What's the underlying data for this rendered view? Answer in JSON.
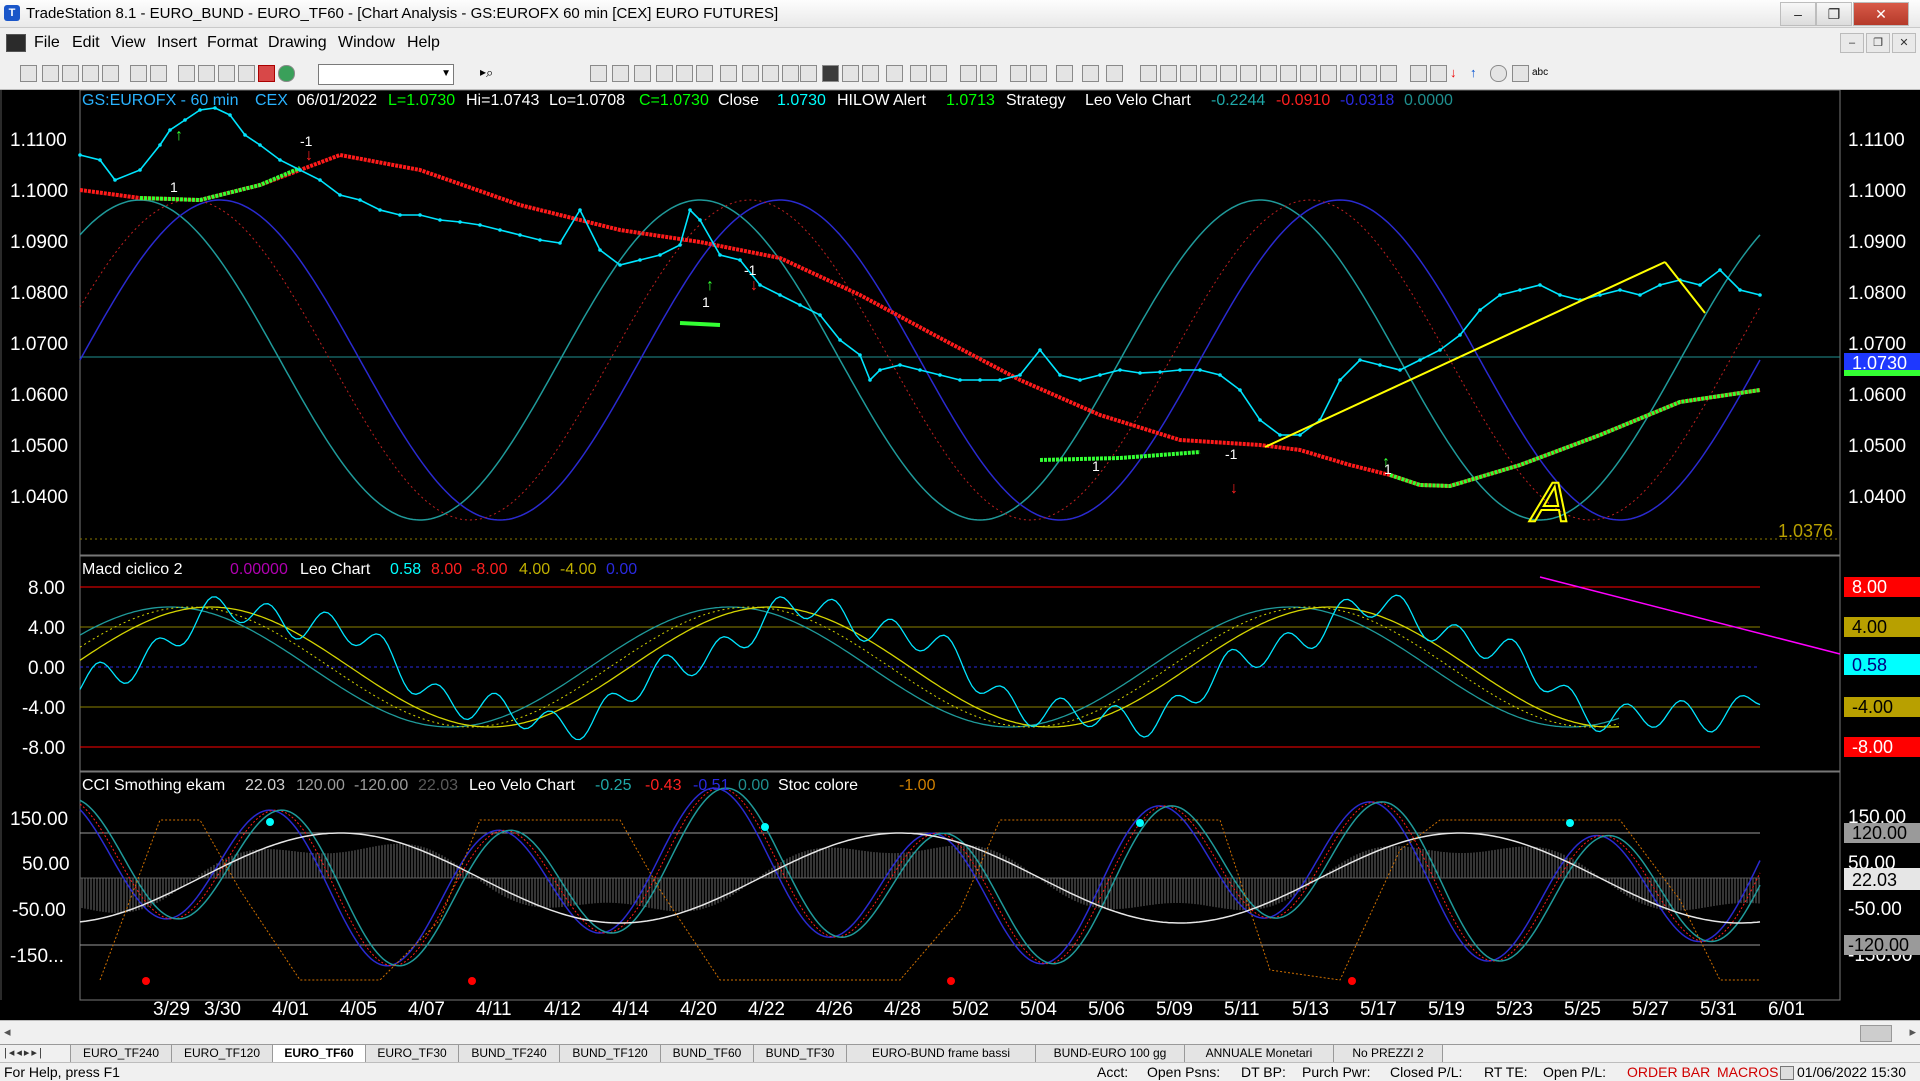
{
  "window": {
    "title": "TradeStation 8.1 - EURO_BUND - EURO_TF60 - [Chart Analysis - GS:EUROFX  60 min  [CEX] EURO FUTURES]",
    "minimize_glyph": "–",
    "restore_glyph": "❐",
    "close_glyph": "✕"
  },
  "menu": [
    "File",
    "Edit",
    "View",
    "Insert",
    "Format",
    "Drawing",
    "Window",
    "Help"
  ],
  "mdi_buttons": [
    "–",
    "❐",
    "✕"
  ],
  "chart_header": {
    "symbol": "GS:EUROFX - 60 min",
    "exchange": "CEX",
    "date": "06/01/2022",
    "last": "L=1.0730",
    "hi": "Hi=1.0743",
    "lo": "Lo=1.0708",
    "close": "C=1.0730",
    "close_label": "Close",
    "close_value": "1.0730",
    "hilow_label": "HILOW Alert",
    "hilow_value": "1.0713",
    "strategy_label": "Strategy",
    "leo_label": "Leo Velo Chart",
    "leo_v1": "-0.2244",
    "leo_v2": "-0.0910",
    "leo_v3": "-0.0318",
    "leo_v4": "0.0000"
  },
  "macd_header": {
    "name": "Macd ciclico 2",
    "v0": "0.00000",
    "leo_label": "Leo Chart",
    "v1": "0.58",
    "v2": "8.00",
    "v3": "-8.00",
    "v4": "4.00",
    "v5": "-4.00",
    "v6": "0.00"
  },
  "cci_header": {
    "name": "CCI Smothing ekam",
    "v1": "22.03",
    "v2": "120.00",
    "v3": "-120.00",
    "v4": "22.03",
    "leo_label": "Leo Velo Chart",
    "l1": "-0.25",
    "l2": "-0.43",
    "l3": "-0.51",
    "l4": "0.00",
    "stoc_label": "Stoc colore",
    "stoc_value": "-1.00"
  },
  "price_axis_labels": [
    "1.1100",
    "1.1000",
    "1.0900",
    "1.0800",
    "1.0700",
    "1.0600",
    "1.0500",
    "1.0400"
  ],
  "price_tag": "1.0730",
  "low_marker": "1.0376",
  "macd_axis_labels": [
    "8.00",
    "4.00",
    "0.00",
    "-4.00",
    "-8.00"
  ],
  "macd_tags": [
    "8.00",
    "4.00",
    "0.58",
    "-4.00",
    "-8.00"
  ],
  "cci_axis_labels": [
    "150.00",
    "50.00",
    "-50.00",
    "-150..."
  ],
  "cci_right_labels": [
    "150.00",
    "50.00",
    "-50.00",
    "-150.00"
  ],
  "cci_tags": [
    "120.00",
    "22.03",
    "-120.00"
  ],
  "dates": [
    "3/29",
    "3/30",
    "4/01",
    "4/05",
    "4/07",
    "4/11",
    "4/12",
    "4/14",
    "4/20",
    "4/22",
    "4/26",
    "4/28",
    "5/02",
    "5/04",
    "5/06",
    "5/09",
    "5/11",
    "5/13",
    "5/17",
    "5/19",
    "5/23",
    "5/25",
    "5/27",
    "5/31",
    "6/01"
  ],
  "signals": [
    "1",
    "-1",
    "1",
    "-1",
    "1",
    "-1",
    "1"
  ],
  "annotation_A": "A",
  "tabs": [
    "EURO_TF240",
    "EURO_TF120",
    "EURO_TF60",
    "EURO_TF30",
    "BUND_TF240",
    "BUND_TF120",
    "BUND_TF60",
    "BUND_TF30",
    "EURO-BUND frame bassi",
    "BUND-EURO 100 gg",
    "ANNUALE Monetari",
    "No PREZZI 2"
  ],
  "active_tab": 2,
  "status": {
    "help": "For Help, press F1",
    "acct": "Acct:",
    "open_psns": "Open Psns:",
    "dt_bp": "DT BP:",
    "purch_pwr": "Purch Pwr:",
    "closed_pl": "Closed P/L:",
    "rt_te": "RT TE:",
    "open_pl": "Open P/L:",
    "order_bar": "ORDER BAR",
    "macros": "MACROS",
    "datetime": "01/06/2022 15:30"
  },
  "colors": {
    "price": "#00e5ff",
    "ma_down": "#ff1a1a",
    "ma_up": "#33ff33",
    "cycle_teal": "#1f9a9a",
    "cycle_blue": "#2a2ad0",
    "cycle_red_dot": "#c02020",
    "trendline": "#ffff00",
    "magenta": "#ff00ff",
    "tag_red": "#ff0000",
    "tag_cyan": "#00ffff",
    "tag_blue": "#1e38ff"
  }
}
